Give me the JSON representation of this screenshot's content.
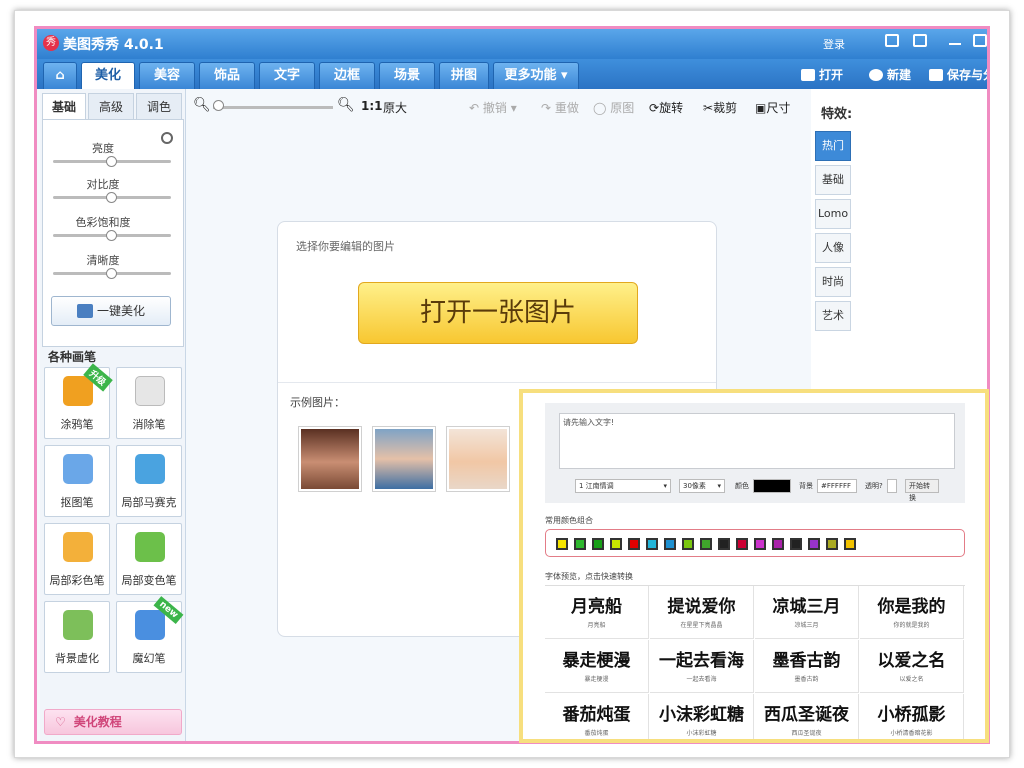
{
  "window": {
    "title": "美图秀秀 4.0.1",
    "logo": "秀",
    "login": "登录"
  },
  "nav": {
    "tabs": [
      "美化",
      "美容",
      "饰品",
      "文字",
      "边框",
      "场景",
      "拼图",
      "更多功能"
    ],
    "more_arrow": "▾",
    "active": "美化",
    "open": "打开",
    "new": "新建",
    "save": "保存与分"
  },
  "left": {
    "subtabs": [
      "基础",
      "高级",
      "调色"
    ],
    "sliders": [
      {
        "label": "亮度",
        "level": 0.5
      },
      {
        "label": "对比度",
        "level": 0.5
      },
      {
        "label": "色彩饱和度",
        "level": 0.5
      },
      {
        "label": "清晰度",
        "level": 0.5
      }
    ],
    "one_key": "一键美化",
    "brush_title": "各种画笔",
    "brushes": [
      {
        "label": "涂鸦笔",
        "badge": "升级",
        "color": "#f0a020"
      },
      {
        "label": "消除笔",
        "badge": "",
        "color": "#e6e6e6"
      },
      {
        "label": "抠图笔",
        "badge": "",
        "color": "#6aa7e8"
      },
      {
        "label": "局部马赛克",
        "badge": "",
        "color": "#4aa3e0"
      },
      {
        "label": "局部彩色笔",
        "badge": "",
        "color": "#f3b03a"
      },
      {
        "label": "局部变色笔",
        "badge": "",
        "color": "#6cc04a"
      },
      {
        "label": "背景虚化",
        "badge": "",
        "color": "#7dbf5a"
      },
      {
        "label": "魔幻笔",
        "badge": "new",
        "color": "#4a8fe0"
      }
    ],
    "tutorial": "美化教程"
  },
  "toolbar": {
    "ratio": "1:1",
    "original_size": "原大",
    "undo": "撤销",
    "redo": "重做",
    "restore": "原图",
    "rotate": "旋转",
    "crop": "裁剪",
    "resize": "尺寸"
  },
  "center": {
    "hint": "选择你要编辑的图片",
    "open_button": "打开一张图片",
    "examples_label": "示例图片："
  },
  "effects": {
    "title": "特效:",
    "tabs": [
      "热门",
      "基础",
      "Lomo",
      "人像",
      "时尚",
      "艺术"
    ],
    "active": "热门"
  },
  "text_tool": {
    "placeholder": "请先输入文字!",
    "font_select": "1 江南情调",
    "size_select": "30像素",
    "color_label": "颜色",
    "bg_label": "背景",
    "bg_value": "#FFFFFF",
    "transparent_label": "透明?",
    "start_button": "开始转换",
    "color_combo_title": "常用颜色组合",
    "swatches": [
      "#f5e400",
      "#2eb82e",
      "#18a018",
      "#c6e600",
      "#e00000",
      "#22b5d9",
      "#1e90d0",
      "#7ac70f",
      "#3fa52b",
      "#222222",
      "#cc0033",
      "#cc33cc",
      "#aa22aa",
      "#222222",
      "#9933cc",
      "#aaaa22",
      "#f2c200"
    ],
    "font_preview_title": "字体预览，点击快速转换",
    "font_previews": [
      {
        "text": "月亮船",
        "caption": "月亮船"
      },
      {
        "text": "提说爱你",
        "caption": "在星星下亮晶晶"
      },
      {
        "text": "凉城三月",
        "caption": "凉城三月"
      },
      {
        "text": "你是我的",
        "caption": "你的就是我的"
      },
      {
        "text": "暴走梗漫",
        "caption": "暴走梗漫"
      },
      {
        "text": "一起去看海",
        "caption": "一起去看海"
      },
      {
        "text": "墨香古韵",
        "caption": "墨香古韵"
      },
      {
        "text": "以爱之名",
        "caption": "以爱之名"
      },
      {
        "text": "番茄炖蛋",
        "caption": "番茄炖蛋"
      },
      {
        "text": "小沫彩虹糖",
        "caption": "小沫彩虹糖"
      },
      {
        "text": "西瓜圣诞夜",
        "caption": "西瓜圣诞夜"
      },
      {
        "text": "小桥孤影",
        "caption": "小桥清香暗花影"
      }
    ]
  }
}
